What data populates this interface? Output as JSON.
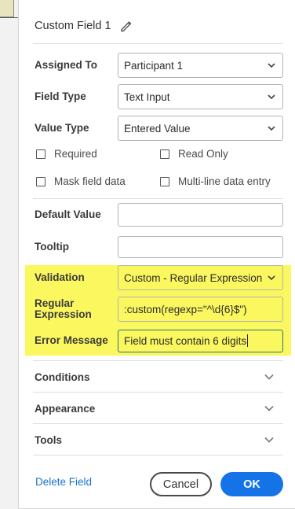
{
  "dialog": {
    "title": "Custom Field 1",
    "fields": {
      "assigned_to": {
        "label": "Assigned To",
        "value": "Participant 1"
      },
      "field_type": {
        "label": "Field Type",
        "value": "Text Input"
      },
      "value_type": {
        "label": "Value Type",
        "value": "Entered Value"
      }
    },
    "checkboxes": {
      "required": "Required",
      "read_only": "Read Only",
      "mask_field_data": "Mask field data",
      "multi_line": "Multi-line data entry"
    },
    "default_value": {
      "label": "Default Value",
      "value": ""
    },
    "tooltip": {
      "label": "Tooltip",
      "value": ""
    },
    "validation": {
      "label": "Validation",
      "value": "Custom - Regular Expression"
    },
    "regular_expression": {
      "label_line1": "Regular",
      "label_line2": "Expression",
      "value": ":custom(regexp=\"^\\d{6}$\")"
    },
    "error_message": {
      "label": "Error Message",
      "value": "Field must contain 6 digits"
    },
    "sections": {
      "conditions": "Conditions",
      "appearance": "Appearance",
      "tools": "Tools"
    },
    "footer": {
      "delete_label": "Delete Field",
      "cancel_label": "Cancel",
      "ok_label": "OK"
    }
  },
  "colors": {
    "highlight": "#fbf75f",
    "primary": "#1473e6",
    "link": "#1a73c9"
  },
  "icons": {
    "edit": "pencil-icon",
    "dropdown": "chevron-down-icon"
  }
}
